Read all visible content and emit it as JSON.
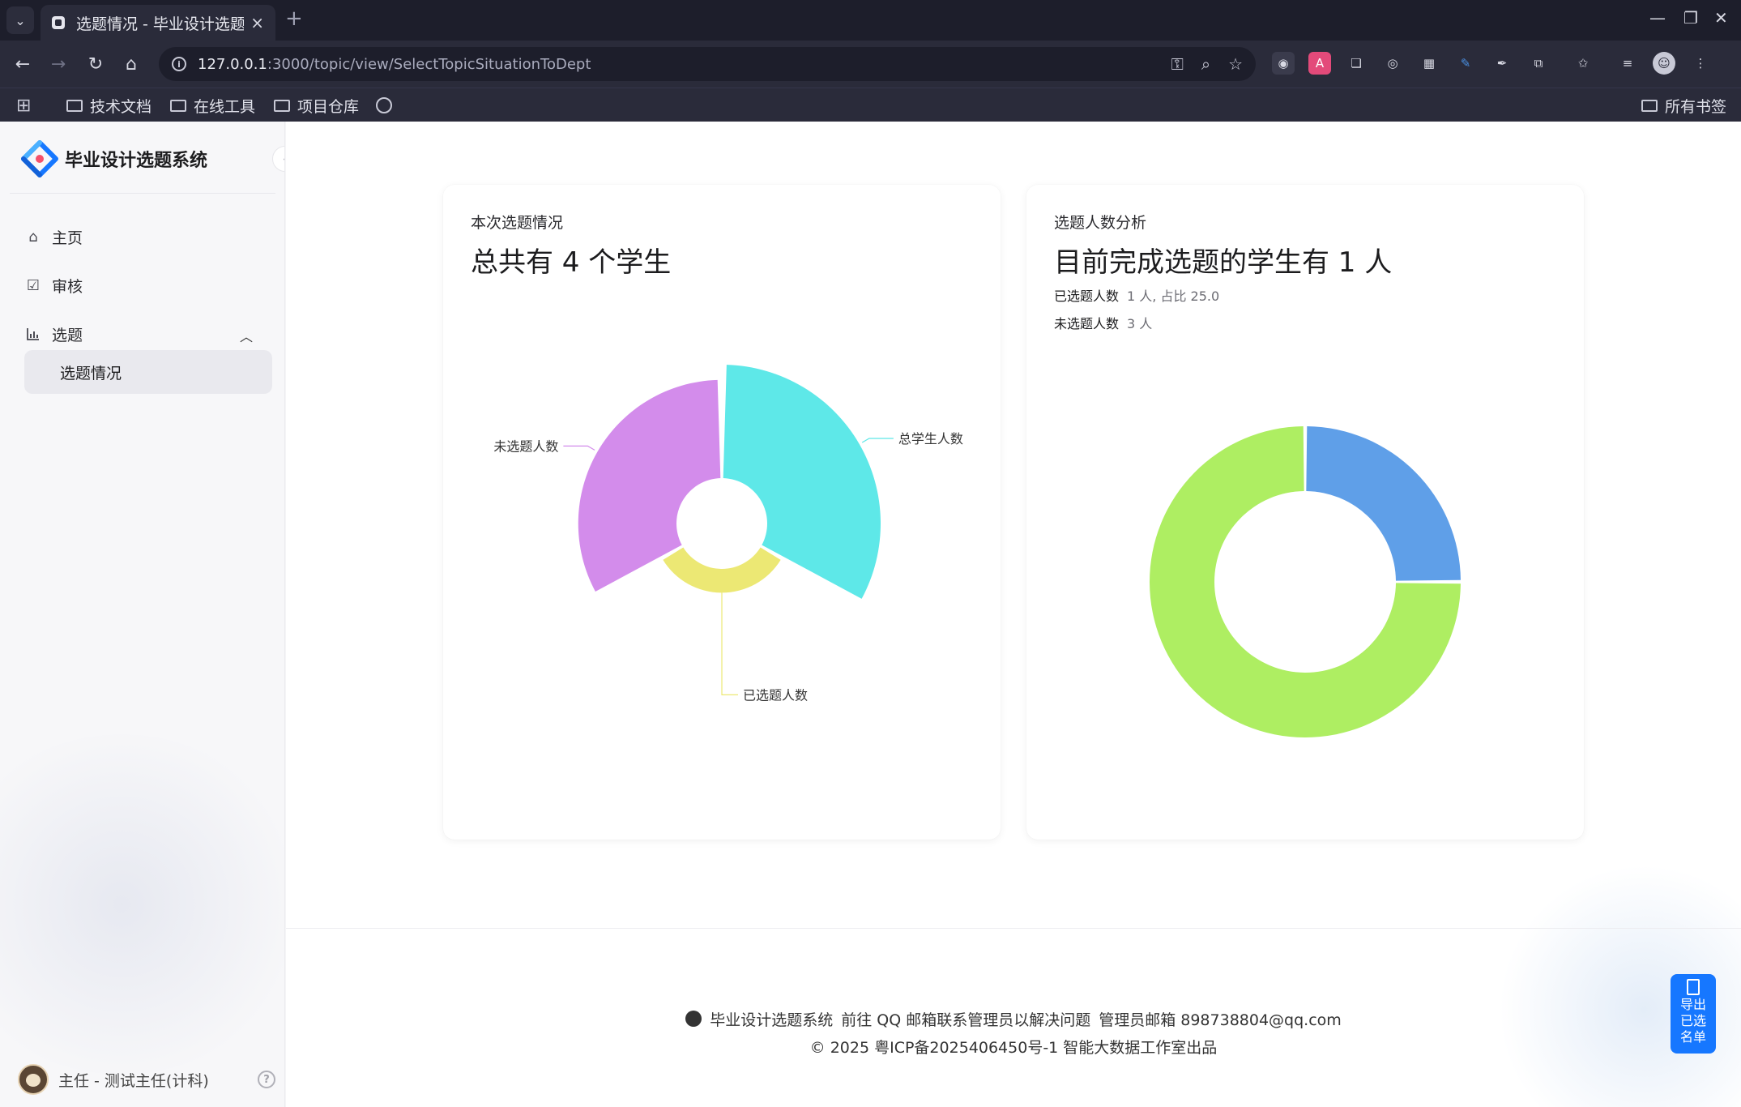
{
  "browser": {
    "tab_title": "选题情况 - 毕业设计选题系",
    "url_host": "127.0.0.1",
    "url_path": ":3000/topic/view/SelectTopicSituationToDept",
    "bookmarks": [
      "技术文档",
      "在线工具",
      "项目仓库"
    ],
    "all_bookmarks": "所有书签"
  },
  "sidebar": {
    "brand": "毕业设计选题系统",
    "menu": {
      "home": "主页",
      "review": "审核",
      "topic": "选题",
      "topic_situation": "选题情况"
    },
    "user": "主任 - 测试主任(计科)"
  },
  "left_card": {
    "label": "本次选题情况",
    "heading": "总共有 4 个学生"
  },
  "right_card": {
    "label": "选题人数分析",
    "heading": "目前完成选题的学生有 1 人",
    "selected_label": "已选题人数",
    "selected_value": "1 人, 占比 25.0",
    "unselected_label": "未选题人数",
    "unselected_value": "3 人"
  },
  "chart_data": [
    {
      "type": "pie",
      "variant": "nightingale-rose",
      "categories": [
        "总学生人数",
        "已选题人数",
        "未选题人数"
      ],
      "values": [
        4,
        1,
        3
      ],
      "colors": [
        "#5ee8e8",
        "#ece874",
        "#d38ceb"
      ],
      "labels": [
        "总学生人数",
        "已选题人数",
        "未选题人数"
      ]
    },
    {
      "type": "pie",
      "variant": "donut",
      "categories": [
        "已选题人数",
        "未选题人数"
      ],
      "values": [
        1,
        3
      ],
      "colors": [
        "#5f9fe8",
        "#aeee62"
      ]
    }
  ],
  "footer": {
    "line1_system": "毕业设计选题系统",
    "line1_contact": "前往 QQ 邮箱联系管理员以解决问题",
    "line1_email": "管理员邮箱 898738804@qq.com",
    "line2": "© 2025 粤ICP备2025406450号-1 智能大数据工作室出品"
  },
  "export_button": [
    "导出",
    "已选",
    "名单"
  ]
}
